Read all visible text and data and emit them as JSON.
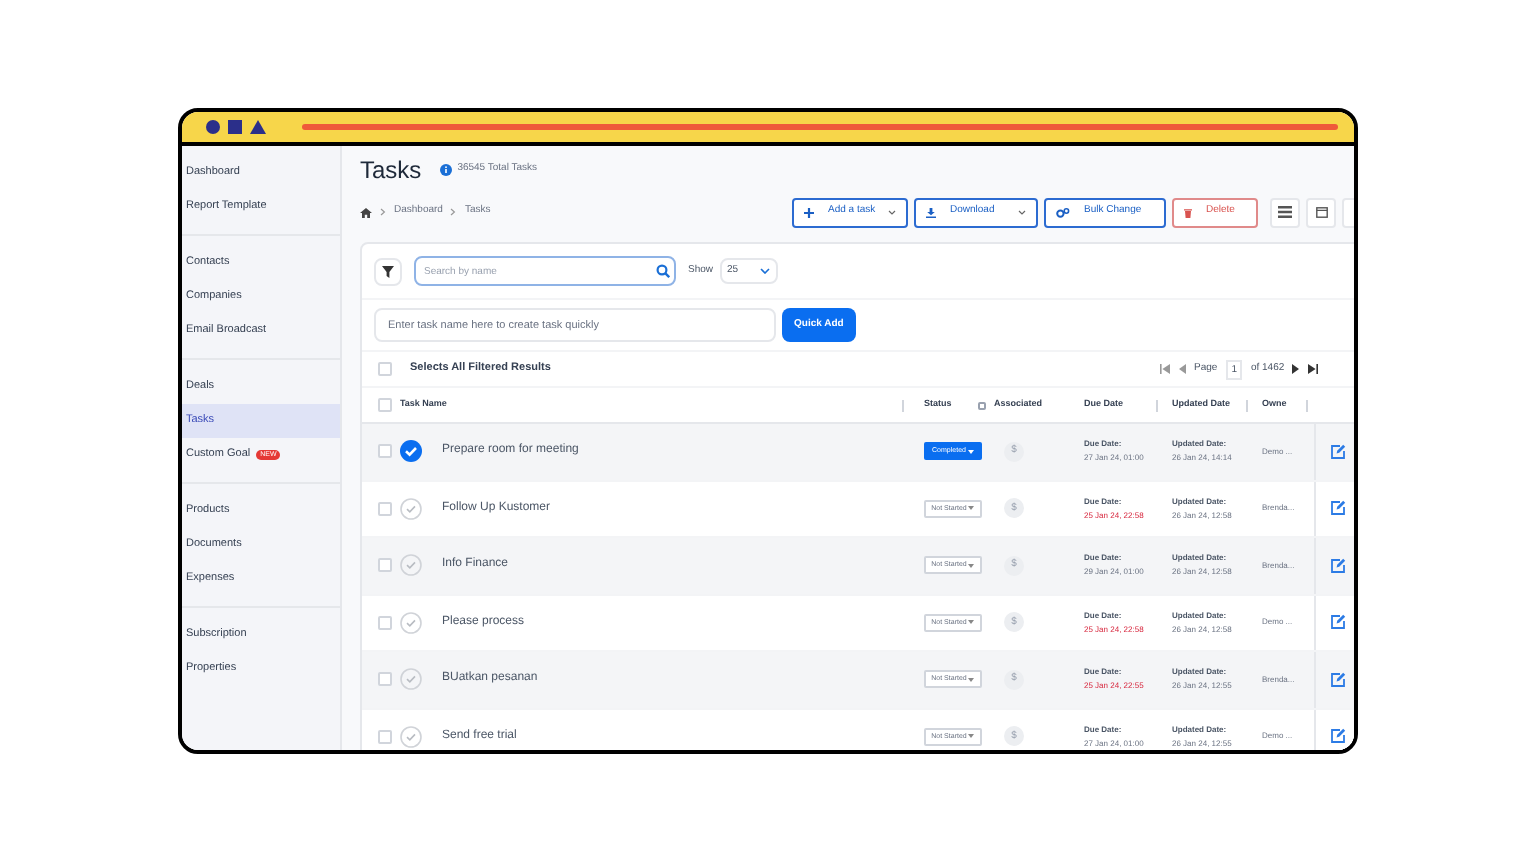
{
  "sidebar": {
    "groups": [
      [
        {
          "label": "Dashboard",
          "selected": false
        },
        {
          "label": "Report Template",
          "selected": false
        }
      ],
      [
        {
          "label": "Contacts",
          "selected": false
        },
        {
          "label": "Companies",
          "selected": false
        },
        {
          "label": "Email Broadcast",
          "selected": false
        }
      ],
      [
        {
          "label": "Deals",
          "selected": false
        },
        {
          "label": "Tasks",
          "selected": true
        },
        {
          "label": "Custom Goal",
          "selected": false,
          "badge": "NEW"
        }
      ],
      [
        {
          "label": "Products",
          "selected": false
        },
        {
          "label": "Documents",
          "selected": false
        },
        {
          "label": "Expenses",
          "selected": false
        }
      ],
      [
        {
          "label": "Subscription",
          "selected": false
        },
        {
          "label": "Properties",
          "selected": false
        }
      ]
    ]
  },
  "header": {
    "title": "Tasks",
    "count": "36545 Total Tasks",
    "breadcrumb": [
      "Dashboard",
      "Tasks"
    ]
  },
  "toolbar": {
    "buttons": [
      {
        "kind": "add",
        "label": "Add a task",
        "dropdown": true
      },
      {
        "kind": "download",
        "label": "Download",
        "dropdown": true
      },
      {
        "kind": "bulk",
        "label": "Bulk Change",
        "dropdown": false
      },
      {
        "kind": "delete",
        "label": "Delete",
        "dropdown": false
      }
    ]
  },
  "filters": {
    "search_placeholder": "Search by name",
    "show_label": "Show",
    "show_value": "25",
    "quick_add_placeholder": "Enter task name here to create task quickly",
    "quick_add_button": "Quick Add"
  },
  "select_all": {
    "label": "Selects All Filtered Results",
    "checked": false
  },
  "pagination": {
    "label": "Page",
    "page": "1",
    "total": "of 1462"
  },
  "table": {
    "header_checked": false,
    "columns": [
      "Task Name",
      "Status",
      "Associated",
      "Due Date",
      "Updated Date",
      "Owne"
    ],
    "rows": [
      {
        "checked": false,
        "completed": true,
        "name": "Prepare room for meeting",
        "status": "Completed",
        "associated": "$",
        "due_label": "Due Date:",
        "due": "27 Jan 24, 01:00",
        "overdue": false,
        "updated_label": "Updated Date:",
        "updated": "26 Jan 24, 14:14",
        "owner": "Demo ..."
      },
      {
        "checked": false,
        "completed": false,
        "name": "Follow Up Kustomer",
        "status": "Not Started",
        "associated": "$",
        "due_label": "Due Date:",
        "due": "25 Jan 24, 22:58",
        "overdue": true,
        "updated_label": "Updated Date:",
        "updated": "26 Jan 24, 12:58",
        "owner": "Brenda..."
      },
      {
        "checked": false,
        "completed": false,
        "name": "Info Finance",
        "status": "Not Started",
        "associated": "$",
        "due_label": "Due Date:",
        "due": "29 Jan 24, 01:00",
        "overdue": false,
        "updated_label": "Updated Date:",
        "updated": "26 Jan 24, 12:58",
        "owner": "Brenda..."
      },
      {
        "checked": false,
        "completed": false,
        "name": "Please process",
        "status": "Not Started",
        "associated": "$",
        "due_label": "Due Date:",
        "due": "25 Jan 24, 22:58",
        "overdue": true,
        "updated_label": "Updated Date:",
        "updated": "26 Jan 24, 12:58",
        "owner": "Demo ..."
      },
      {
        "checked": false,
        "completed": false,
        "name": "BUatkan pesanan",
        "status": "Not Started",
        "associated": "$",
        "due_label": "Due Date:",
        "due": "25 Jan 24, 22:55",
        "overdue": true,
        "updated_label": "Updated Date:",
        "updated": "26 Jan 24, 12:55",
        "owner": "Brenda..."
      },
      {
        "checked": false,
        "completed": false,
        "name": "Send free trial",
        "status": "Not Started",
        "associated": "$",
        "due_label": "Due Date:",
        "due": "27 Jan 24, 01:00",
        "overdue": false,
        "updated_label": "Updated Date:",
        "updated": "26 Jan 24, 12:55",
        "owner": "Demo ..."
      }
    ]
  }
}
